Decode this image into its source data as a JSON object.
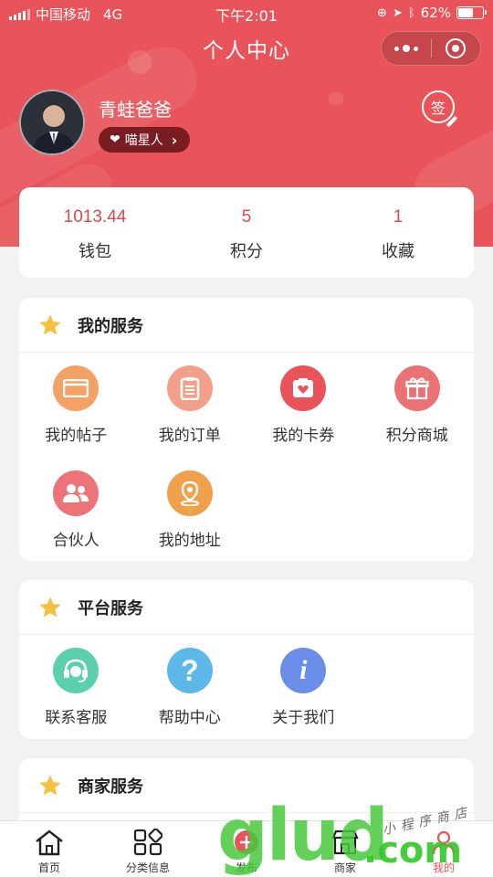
{
  "status_bar": {
    "carrier": "中国移动",
    "network": "4G",
    "time": "下午2:01",
    "battery": "62%",
    "battery_level": 0.62
  },
  "nav": {
    "title": "个人中心"
  },
  "profile": {
    "name": "青蛙爸爸",
    "level": "喵星人",
    "sign_label": "签"
  },
  "stats": [
    {
      "value": "1013.44",
      "label": "钱包"
    },
    {
      "value": "5",
      "label": "积分"
    },
    {
      "value": "1",
      "label": "收藏"
    }
  ],
  "sections": {
    "my_services": {
      "title": "我的服务",
      "items": [
        {
          "label": "我的帖子",
          "icon": "post-card-icon",
          "color": "#f3a165"
        },
        {
          "label": "我的订单",
          "icon": "clipboard-icon",
          "color": "#f2a08a"
        },
        {
          "label": "我的卡券",
          "icon": "coupon-heart-icon",
          "color": "#e8545a"
        },
        {
          "label": "积分商城",
          "icon": "gift-icon",
          "color": "#ea7174"
        },
        {
          "label": "合伙人",
          "icon": "partners-icon",
          "color": "#ec7478"
        },
        {
          "label": "我的地址",
          "icon": "location-pin-icon",
          "color": "#f0a04b"
        }
      ]
    },
    "platform_services": {
      "title": "平台服务",
      "items": [
        {
          "label": "联系客服",
          "icon": "headset-icon",
          "color": "#5ccfae"
        },
        {
          "label": "帮助中心",
          "icon": "question-icon",
          "color": "#5bb8e8"
        },
        {
          "label": "关于我们",
          "icon": "info-icon",
          "color": "#6a8de8"
        }
      ]
    },
    "merchant_services": {
      "title": "商家服务"
    }
  },
  "tabbar": [
    {
      "label": "首页",
      "icon": "home-icon"
    },
    {
      "label": "分类信息",
      "icon": "category-grid-icon"
    },
    {
      "label": "发布",
      "icon": "publish-plus-icon"
    },
    {
      "label": "商家",
      "icon": "store-icon"
    },
    {
      "label": "我的",
      "icon": "user-icon",
      "active": true
    }
  ],
  "watermark": {
    "text": "glud",
    "suffix": ".com",
    "tagline": "小程序商店"
  },
  "colors": {
    "brand": "#e8545a",
    "badge": "#7a1d22",
    "star": "#f6c23e"
  }
}
